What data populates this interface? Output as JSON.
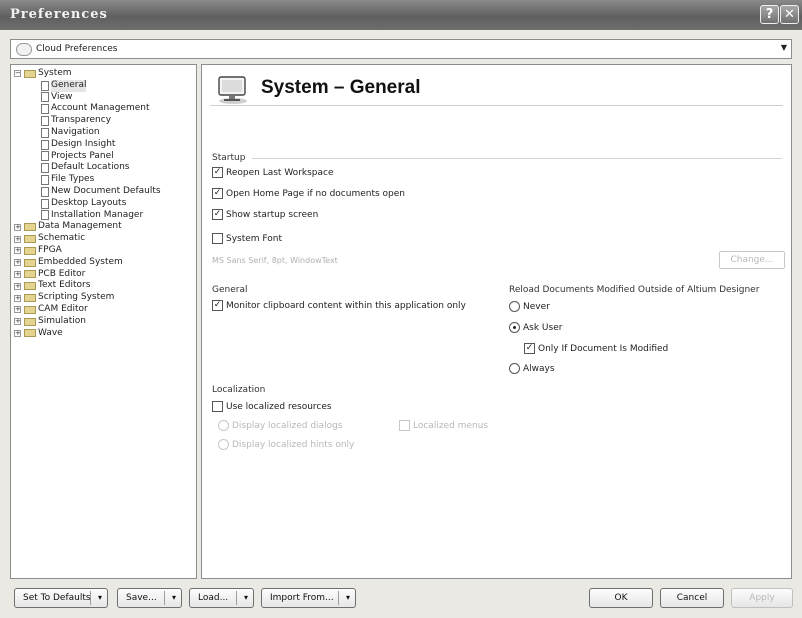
{
  "window": {
    "title": "Preferences",
    "help_button": "?",
    "close_button": "✕"
  },
  "cloud": {
    "label": "Cloud Preferences"
  },
  "tree": [
    {
      "label": "System",
      "level": 0,
      "expander": "−"
    },
    {
      "label": "General",
      "level": 1,
      "selected": true
    },
    {
      "label": "View",
      "level": 1
    },
    {
      "label": "Account Management",
      "level": 1
    },
    {
      "label": "Transparency",
      "level": 1
    },
    {
      "label": "Navigation",
      "level": 1
    },
    {
      "label": "Design Insight",
      "level": 1
    },
    {
      "label": "Projects Panel",
      "level": 1
    },
    {
      "label": "Default Locations",
      "level": 1
    },
    {
      "label": "File Types",
      "level": 1
    },
    {
      "label": "New Document Defaults",
      "level": 1
    },
    {
      "label": "Desktop Layouts",
      "level": 1
    },
    {
      "label": "Installation Manager",
      "level": 1
    },
    {
      "label": "Data Management",
      "level": 0,
      "expander": "+"
    },
    {
      "label": "Schematic",
      "level": 0,
      "expander": "+"
    },
    {
      "label": "FPGA",
      "level": 0,
      "expander": "+"
    },
    {
      "label": "Embedded System",
      "level": 0,
      "expander": "+"
    },
    {
      "label": "PCB Editor",
      "level": 0,
      "expander": "+"
    },
    {
      "label": "Text Editors",
      "level": 0,
      "expander": "+"
    },
    {
      "label": "Scripting System",
      "level": 0,
      "expander": "+"
    },
    {
      "label": "CAM Editor",
      "level": 0,
      "expander": "+"
    },
    {
      "label": "Simulation",
      "level": 0,
      "expander": "+"
    },
    {
      "label": "Wave",
      "level": 0,
      "expander": "+"
    }
  ],
  "page": {
    "title": "System – General"
  },
  "startup": {
    "label": "Startup",
    "reopen_workspace": {
      "label": "Reopen Last Workspace",
      "checked": true
    },
    "open_home_page": {
      "label": "Open Home Page if no documents open",
      "checked": true
    },
    "show_startup": {
      "label": "Show startup screen",
      "checked": true
    }
  },
  "system_font": {
    "label": "System Font",
    "checked": false,
    "description": "MS Sans Serif, 8pt, WindowText",
    "change_label": "Change..."
  },
  "general": {
    "label": "General",
    "monitor_clipboard": {
      "label": "Monitor clipboard content within this application only",
      "checked": true
    }
  },
  "reload": {
    "label": "Reload Documents Modified Outside of Altium Designer",
    "never": "Never",
    "ask_user": "Ask User",
    "only_if_modified": {
      "label": "Only If Document Is Modified",
      "checked": true
    },
    "always": "Always",
    "selected": "ask_user"
  },
  "localization": {
    "label": "Localization",
    "use_localized": {
      "label": "Use localized resources",
      "checked": false
    },
    "display_dialogs": "Display localized dialogs",
    "localized_menus": "Localized menus",
    "display_hints": "Display localized hints only"
  },
  "buttons": {
    "set_defaults": "Set To Defaults",
    "save": "Save...",
    "load": "Load...",
    "import_from": "Import From...",
    "ok": "OK",
    "cancel": "Cancel",
    "apply": "Apply"
  }
}
